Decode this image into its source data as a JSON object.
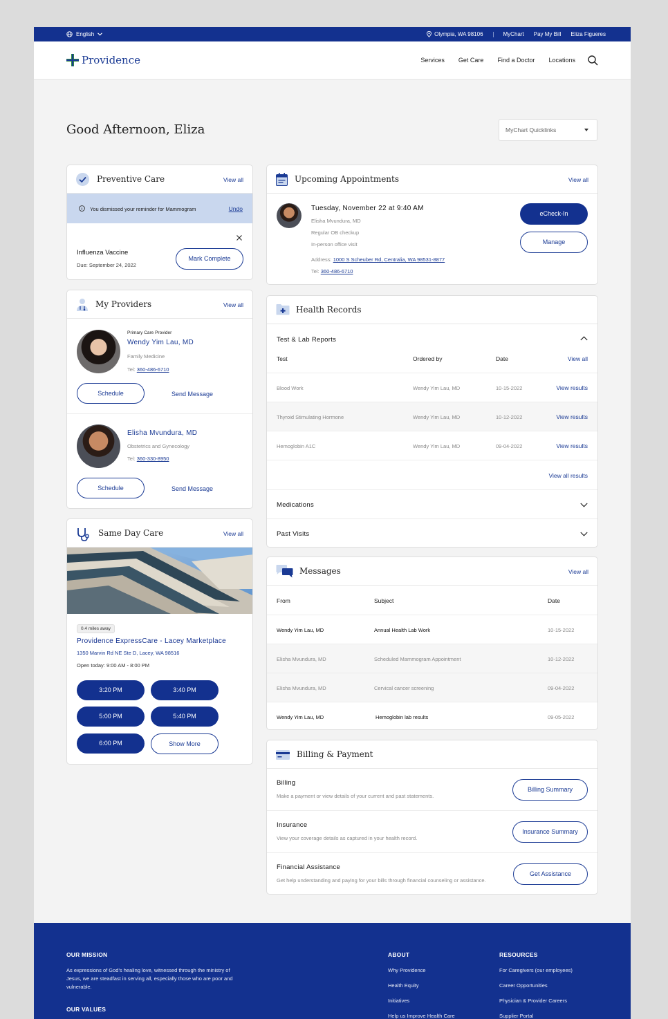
{
  "utility_bar": {
    "language": "English",
    "location": "Olympia, WA 98106",
    "links": [
      "MyChart",
      "Pay My Bill",
      "Eliza Figueres"
    ]
  },
  "header": {
    "brand": "Providence",
    "nav": [
      "Services",
      "Get Care",
      "Find a Doctor",
      "Locations"
    ]
  },
  "greeting": "Good Afternoon, Eliza",
  "quicklinks": {
    "label": "MyChart Quicklinks"
  },
  "view_all": "View all",
  "preventive_care": {
    "title": "Preventive Care",
    "dismissed_text": "You dismissed your reminder for Mammogram",
    "undo": "Undo",
    "item_title": "Influenza Vaccine",
    "item_due": "Due: September 24, 2022",
    "mark_complete": "Mark Complete"
  },
  "my_providers": {
    "title": "My Providers",
    "providers": [
      {
        "tag": "Primary Care Provider",
        "name": "Wendy Yim Lau, MD",
        "specialty": "Family Medicine",
        "tel_label": "Tel:",
        "tel": "360-486-6710"
      },
      {
        "tag": "",
        "name": "Elisha Mvundura, MD",
        "specialty": "Obstetrics and Gynecology",
        "tel_label": "Tel:",
        "tel": "360-330-8950"
      }
    ],
    "schedule": "Schedule",
    "send_message": "Send Message"
  },
  "same_day_care": {
    "title": "Same Day Care",
    "distance": "0.4 miles away",
    "clinic": "Providence ExpressCare - Lacey Marketplace",
    "address": "1350 Marvin Rd NE Ste D, Lacey, WA 98516",
    "hours": "Open today: 9:00 AM - 8:00 PM",
    "times": [
      "3:20 PM",
      "3:40 PM",
      "5:00 PM",
      "5:40 PM",
      "6:00 PM"
    ],
    "show_more": "Show More"
  },
  "appointments": {
    "title": "Upcoming Appointments",
    "when": "Tuesday, November 22 at 9:40 AM",
    "doctor": "Elisha Mvundura, MD",
    "reason": "Regular OB checkup",
    "type": "In-person office visit",
    "address_label": "Address:",
    "address": "1000 S Scheuber Rd, Centralia, WA 98531-8877",
    "tel_label": "Tel:",
    "tel": "360-486-6710",
    "echeckin": "eCheck-In",
    "manage": "Manage"
  },
  "health_records": {
    "title": "Health Records",
    "section": "Test & Lab Reports",
    "columns": [
      "Test",
      "Ordered by",
      "Date"
    ],
    "rows": [
      {
        "test": "Blood Work",
        "by": "Wendy Yim Lau, MD",
        "date": "10-15-2022",
        "action": "View results"
      },
      {
        "test": "Thyroid Stimulating Hormone",
        "by": "Wendy Yim Lau, MD",
        "date": "10-12-2022",
        "action": "View results"
      },
      {
        "test": "Hemoglobin A1C",
        "by": "Wendy Yim Lau, MD",
        "date": "09-04-2022",
        "action": "View results"
      }
    ],
    "view_all_results": "View all results",
    "medications": "Medications",
    "past_visits": "Past Visits"
  },
  "messages": {
    "title": "Messages",
    "columns": [
      "From",
      "Subject",
      "Date"
    ],
    "rows": [
      {
        "from": "Wendy Yim Lau, MD",
        "subject": "Annual Health Lab Work",
        "date": "10-15-2022",
        "unread": true
      },
      {
        "from": "Elisha Mvundura, MD",
        "subject": "Scheduled Mammogram Appointment",
        "date": "10-12-2022",
        "unread": false
      },
      {
        "from": "Elisha Mvundura, MD",
        "subject": "Cervical cancer screening",
        "date": "09-04-2022",
        "unread": false
      },
      {
        "from": "Wendy Yim Lau, MD",
        "subject": "Hemoglobin lab results",
        "date": "09-05-2022",
        "unread": true
      }
    ]
  },
  "billing": {
    "title": "Billing & Payment",
    "items": [
      {
        "title": "Billing",
        "desc": "Make a payment or view details of your current and past statements.",
        "button": "Billing Summary"
      },
      {
        "title": "Insurance",
        "desc": "View your coverage details as captured in your health record.",
        "button": "Insurance Summary"
      },
      {
        "title": "Financial Assistance",
        "desc": "Get help understanding and paying for your bills through financial counseling or assistance.",
        "button": "Get Assistance"
      }
    ]
  },
  "footer": {
    "mission_heading": "OUR MISSION",
    "mission_text": [
      "As expressions of God's healing love, witnessed through the ministry of",
      "Jesus, we are steadfast in serving all, especially those who are poor and",
      "vulnerable."
    ],
    "values_heading": "OUR VALUES",
    "about_heading": "ABOUT",
    "about_links": [
      "Why Providence",
      "Health Equity",
      "Initiatives",
      "Help us Improve Health Care"
    ],
    "resources_heading": "RESOURCES",
    "resources_links": [
      "For Caregivers (our employees)",
      "Career Opportunities",
      "Physician & Provider Careers",
      "Supplier Portal"
    ]
  },
  "colors": {
    "brand": "#13318f",
    "link": "#1a3a94",
    "dismiss_banner": "#c9d7ee"
  }
}
